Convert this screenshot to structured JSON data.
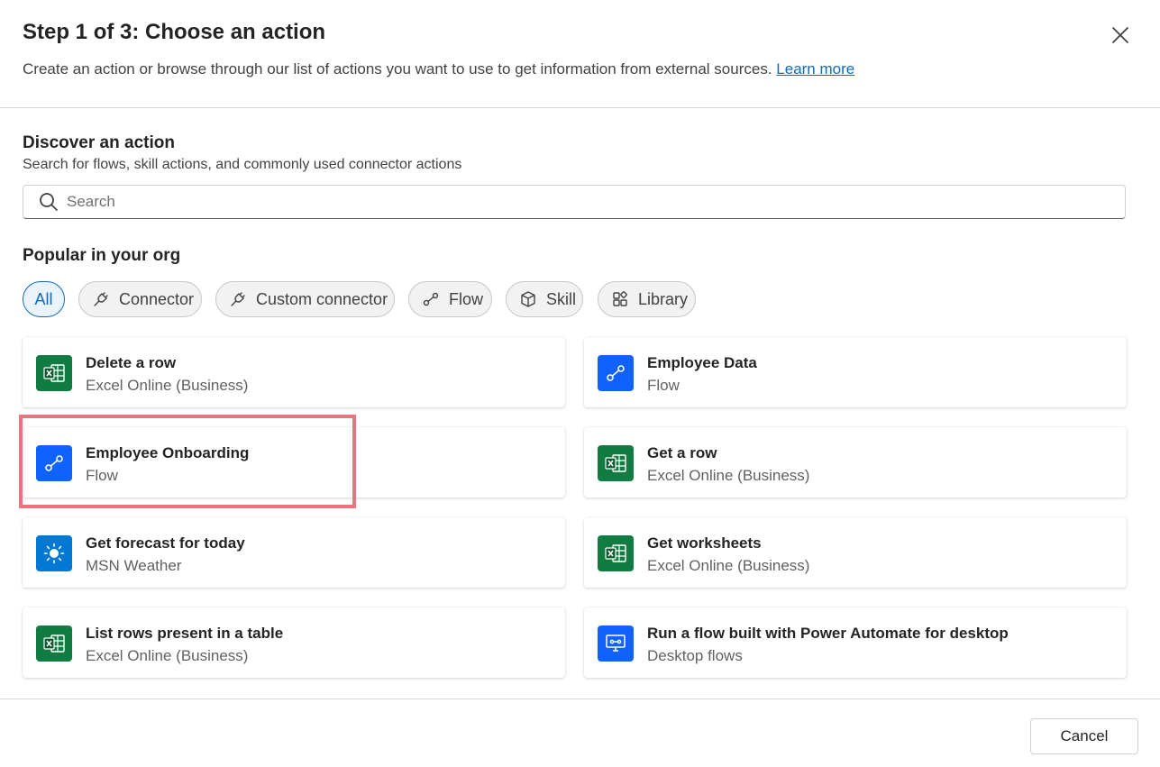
{
  "dialog": {
    "title": "Step 1 of 3: Choose an action",
    "subtitle": "Create an action or browse through our list of actions you want to use to get information from external sources.",
    "learn_more": "Learn more"
  },
  "discover": {
    "title": "Discover an action",
    "subtitle": "Search for flows, skill actions, and commonly used connector actions",
    "search_placeholder": "Search"
  },
  "popular": {
    "title": "Popular in your org",
    "filters": [
      {
        "label": "All",
        "icon": "none",
        "selected": true
      },
      {
        "label": "Connector",
        "icon": "plug-icon",
        "selected": false
      },
      {
        "label": "Custom connector",
        "icon": "plug-icon",
        "selected": false
      },
      {
        "label": "Flow",
        "icon": "flow-icon",
        "selected": false
      },
      {
        "label": "Skill",
        "icon": "cube-icon",
        "selected": false
      },
      {
        "label": "Library",
        "icon": "library-icon",
        "selected": false
      }
    ]
  },
  "actions": [
    {
      "title": "Delete a row",
      "subtitle": "Excel Online (Business)",
      "icon": "excel-icon"
    },
    {
      "title": "Employee Data",
      "subtitle": "Flow",
      "icon": "flow-icon"
    },
    {
      "title": "Employee Onboarding",
      "subtitle": "Flow",
      "icon": "flow-icon",
      "highlighted": true
    },
    {
      "title": "Get a row",
      "subtitle": "Excel Online (Business)",
      "icon": "excel-icon"
    },
    {
      "title": "Get forecast for today",
      "subtitle": "MSN Weather",
      "icon": "sun-icon"
    },
    {
      "title": "Get worksheets",
      "subtitle": "Excel Online (Business)",
      "icon": "excel-icon"
    },
    {
      "title": "List rows present in a table",
      "subtitle": "Excel Online (Business)",
      "icon": "excel-icon"
    },
    {
      "title": "Run a flow built with Power Automate for desktop",
      "subtitle": "Desktop flows",
      "icon": "desktop-flow-icon"
    }
  ],
  "footer": {
    "cancel_label": "Cancel"
  },
  "colors": {
    "accent": "#0f6cbd",
    "excel": "#107c41",
    "flow": "#0f62fe",
    "weather": "#0078d4",
    "highlight": "#e8747c"
  }
}
